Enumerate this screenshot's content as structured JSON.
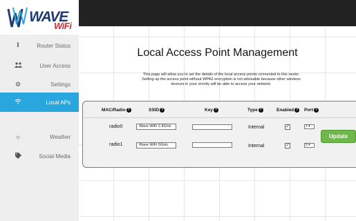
{
  "logo": {
    "main_text": "WAVE",
    "sub_text": "WiFi"
  },
  "sidebar": {
    "items": [
      {
        "label": "Router Status",
        "icon": "info-icon",
        "active": false
      },
      {
        "label": "User Access",
        "icon": "users-icon",
        "active": false
      },
      {
        "label": "Settings",
        "icon": "gears-icon",
        "active": false
      },
      {
        "label": "Local APs",
        "icon": "wifi-icon",
        "active": true
      },
      {
        "label": "Weather",
        "icon": "sun-icon",
        "active": false
      },
      {
        "label": "Social Media",
        "icon": "tag-icon",
        "active": false
      }
    ]
  },
  "main": {
    "title": "Local Access Point Management",
    "description_line1": "This page will allow you to set the details of the local access points connected to this router.",
    "description_line2": "Setting up the access point without WPA2 encryption is not advisable because other wireless",
    "description_line3": "devices in your vicinity will be able to access your network."
  },
  "table": {
    "headers": {
      "mac_radio": "MAC/Radio",
      "ssid": "SSID",
      "key": "Key",
      "type": "Type",
      "enabled": "Enabled",
      "port": "Port"
    },
    "rows": [
      {
        "radio": "radio0",
        "ssid": "Wave WiFi 2.4GHz",
        "key": "",
        "type": "Internal",
        "enabled": true,
        "port": "1"
      },
      {
        "radio": "radio1",
        "ssid": "Wave WiFi 5GHz",
        "key": "",
        "type": "Internal",
        "enabled": true,
        "port": "5"
      }
    ],
    "update_label": "Update"
  },
  "colors": {
    "topbar": "#222222",
    "sidebar_bg": "#eeeeee",
    "active_item": "#29a6dd",
    "update_button": "#6fb64b",
    "logo_blue": "#1f3a73",
    "logo_red": "#e0262b"
  }
}
